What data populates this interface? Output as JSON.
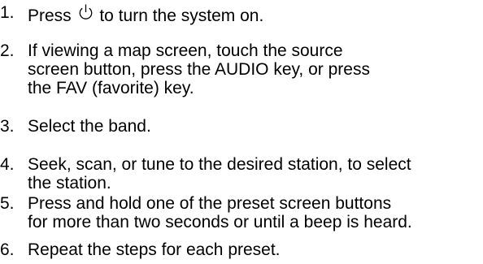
{
  "steps": [
    {
      "number": "1.",
      "before_icon": "Press ",
      "icon": "power-icon",
      "after_icon": " to turn the system on."
    },
    {
      "number": "2.",
      "lines": [
        "If viewing a map screen, touch the source",
        "screen button, press the AUDIO key, or press",
        "the FAV (favorite) key."
      ]
    },
    {
      "number": "3.",
      "lines": [
        "Select the band."
      ]
    },
    {
      "number": "4.",
      "lines": [
        "Seek, scan, or tune to the desired station, to select",
        "the station."
      ]
    },
    {
      "number": "5.",
      "lines": [
        "Press and hold one of the preset screen buttons",
        "for more than two seconds or until a beep is heard."
      ]
    },
    {
      "number": "6.",
      "lines": [
        "Repeat the steps for each preset."
      ]
    }
  ]
}
